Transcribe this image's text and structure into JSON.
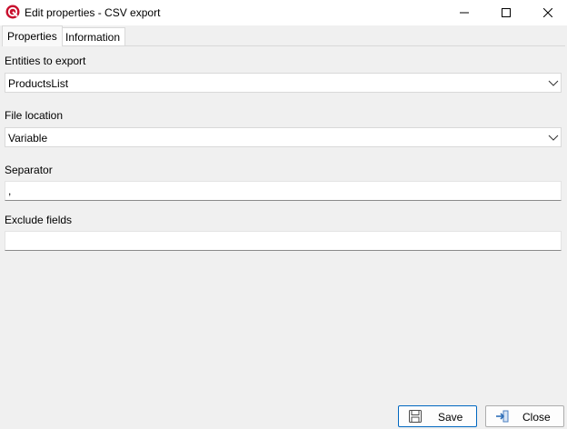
{
  "window": {
    "title": "Edit properties - CSV export",
    "icon": "app-logo-icon",
    "controls": [
      "minimize-icon",
      "maximize-icon",
      "close-icon"
    ]
  },
  "tabs": [
    {
      "label": "Properties",
      "active": true
    },
    {
      "label": "Information",
      "active": false
    }
  ],
  "fields": {
    "entities": {
      "label": "Entities to export",
      "value": "ProductsList"
    },
    "file_location": {
      "label": "File location",
      "value": "Variable"
    },
    "separator": {
      "label": "Separator",
      "value": ","
    },
    "exclude_fields": {
      "label": "Exclude fields",
      "value": ""
    }
  },
  "buttons": {
    "save_label": "Save",
    "close_label": "Close"
  },
  "colors": {
    "accent": "#0067c0",
    "logo": "#c8102e"
  }
}
